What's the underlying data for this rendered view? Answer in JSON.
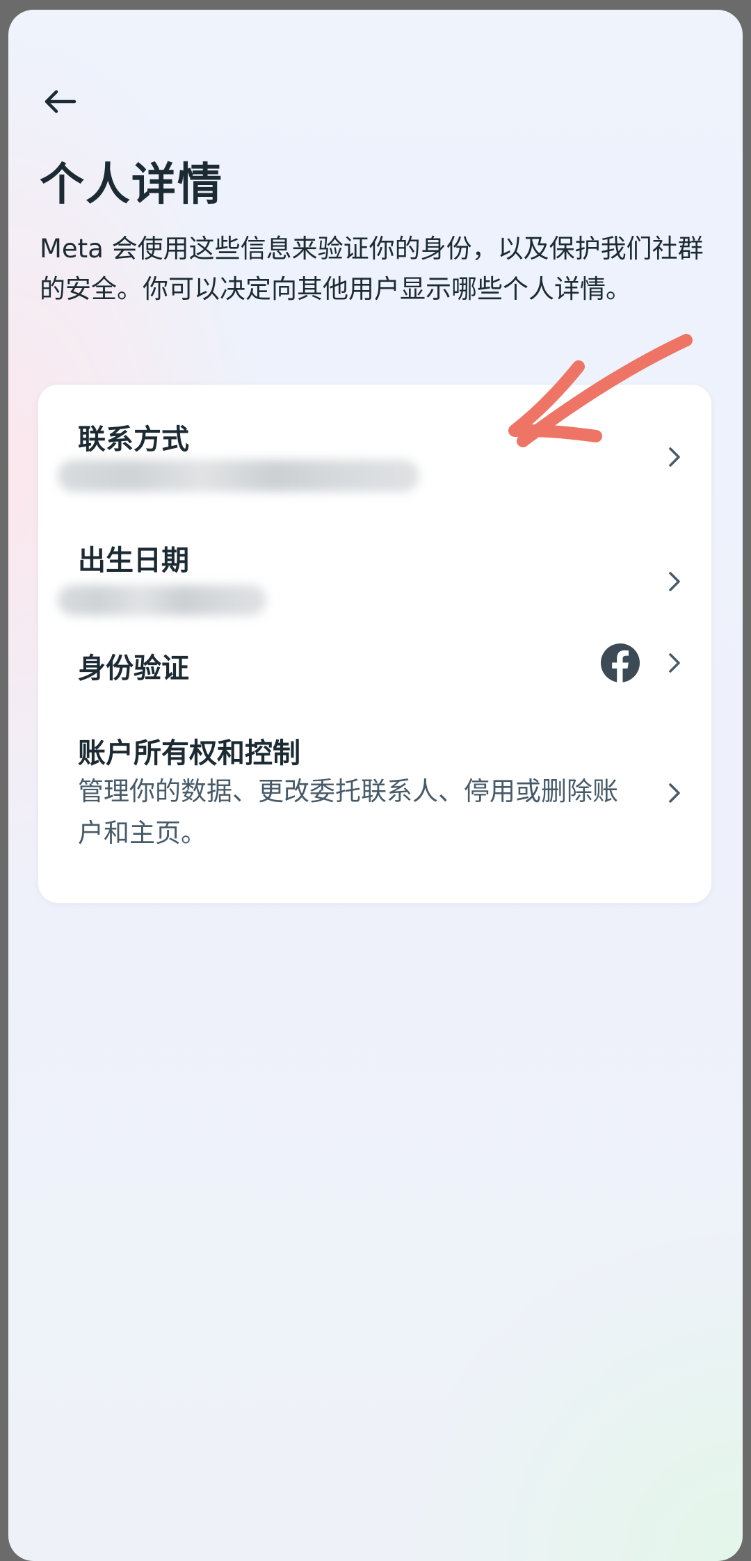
{
  "header": {
    "back_icon": "arrow-left-icon",
    "title": "个人详情",
    "description": "Meta 会使用这些信息来验证你的身份，以及保护我们社群的安全。你可以决定向其他用户显示哪些个人详情。"
  },
  "details": {
    "contact": {
      "label": "联系方式",
      "icon": "chevron-right-icon"
    },
    "birthday": {
      "label": "出生日期",
      "icon": "chevron-right-icon"
    },
    "identity": {
      "label": "身份验证",
      "badge_icon": "facebook-icon",
      "icon": "chevron-right-icon"
    },
    "ownership": {
      "label": "账户所有权和控制",
      "subtitle": "管理你的数据、更改委托联系人、停用或删除账户和主页。",
      "icon": "chevron-right-icon"
    }
  },
  "colors": {
    "text_primary": "#1c2b33",
    "text_secondary": "#465a69",
    "annotation": "#ee7565",
    "facebook_badge": "#3b4a54"
  }
}
